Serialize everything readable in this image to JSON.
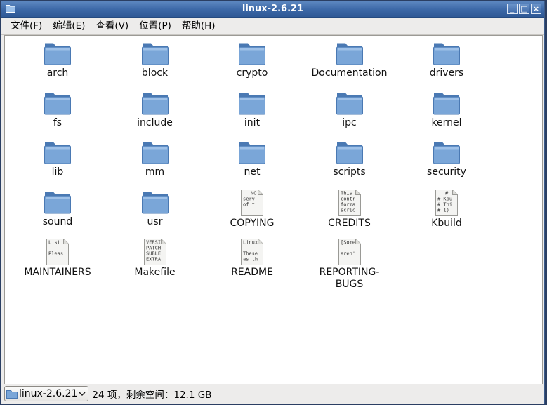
{
  "window": {
    "title": "linux-2.6.21",
    "buttons": [
      "_",
      "□",
      "×"
    ]
  },
  "menubar": {
    "items": [
      "文件(F)",
      "编辑(E)",
      "查看(V)",
      "位置(P)",
      "帮助(H)"
    ]
  },
  "files": [
    {
      "name": "arch",
      "type": "folder"
    },
    {
      "name": "block",
      "type": "folder"
    },
    {
      "name": "crypto",
      "type": "folder"
    },
    {
      "name": "Documentation",
      "type": "folder"
    },
    {
      "name": "drivers",
      "type": "folder"
    },
    {
      "name": "fs",
      "type": "folder"
    },
    {
      "name": "include",
      "type": "folder"
    },
    {
      "name": "init",
      "type": "folder"
    },
    {
      "name": "ipc",
      "type": "folder"
    },
    {
      "name": "kernel",
      "type": "folder"
    },
    {
      "name": "lib",
      "type": "folder"
    },
    {
      "name": "mm",
      "type": "folder"
    },
    {
      "name": "net",
      "type": "folder"
    },
    {
      "name": "scripts",
      "type": "folder"
    },
    {
      "name": "security",
      "type": "folder"
    },
    {
      "name": "sound",
      "type": "folder"
    },
    {
      "name": "usr",
      "type": "folder"
    },
    {
      "name": "COPYING",
      "type": "text",
      "preview": [
        "NO",
        "serv",
        "of t"
      ]
    },
    {
      "name": "CREDITS",
      "type": "text",
      "preview": [
        "This",
        "contr",
        "forma",
        "scric"
      ]
    },
    {
      "name": "Kbuild",
      "type": "text",
      "preview": [
        "#",
        "# Kbu",
        "# Thi",
        "# 1)"
      ]
    },
    {
      "name": "MAINTAINERS",
      "type": "text",
      "preview": [
        "List",
        "",
        "Pleas"
      ]
    },
    {
      "name": "Makefile",
      "type": "text",
      "preview": [
        "VERSI",
        "PATCH",
        "SUBLE",
        "EXTRA"
      ]
    },
    {
      "name": "README",
      "type": "text",
      "preview": [
        "Linux",
        "",
        "These",
        "as th"
      ]
    },
    {
      "name": "REPORTING-BUGS",
      "type": "text",
      "preview": [
        "[Some",
        "",
        "aren'"
      ]
    }
  ],
  "statusbar": {
    "location": "linux-2.6.21",
    "summary": "24 项，剩余空间：12.1 GB"
  },
  "colors": {
    "folder_fill": "#7aa6d8",
    "folder_dark": "#4a79b3",
    "titlebar": "#3b67a6"
  },
  "icons": {
    "folder": "folder-icon",
    "text": "text-file-icon",
    "app": "folder-window-icon",
    "dropdown": "chevron-down-icon"
  }
}
